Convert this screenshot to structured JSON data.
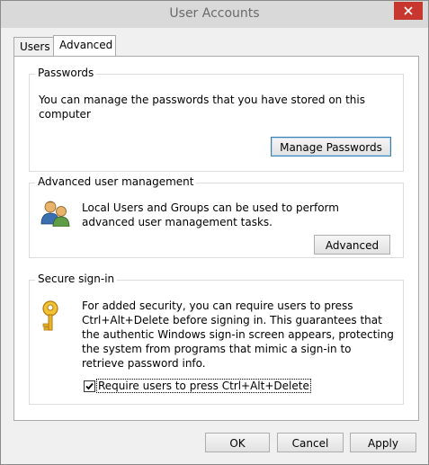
{
  "window": {
    "title": "User Accounts"
  },
  "tabs": [
    {
      "label": "Users",
      "selected": false
    },
    {
      "label": "Advanced",
      "selected": true
    }
  ],
  "passwords": {
    "title": "Passwords",
    "text": "You can manage the passwords that you have stored on this computer",
    "button_label": "Manage Passwords"
  },
  "advanced_management": {
    "title": "Advanced user management",
    "text": "Local Users and Groups can be used to perform advanced user management tasks.",
    "button_label": "Advanced",
    "icon": "users-group-icon"
  },
  "secure_signin": {
    "title": "Secure sign-in",
    "text": "For added security, you can require users to press Ctrl+Alt+Delete before signing in. This guarantees that the authentic Windows sign-in screen appears, protecting the system from programs that mimic a sign-in to retrieve password info.",
    "checkbox_label": "Require users to press Ctrl+Alt+Delete",
    "checked": true,
    "icon": "key-icon"
  },
  "footer": {
    "ok": "OK",
    "cancel": "Cancel",
    "apply": "Apply"
  },
  "colors": {
    "close_button": "#c7372f",
    "titlebar": "#d9d9d9",
    "dialog_bg": "#f0f0f0"
  }
}
